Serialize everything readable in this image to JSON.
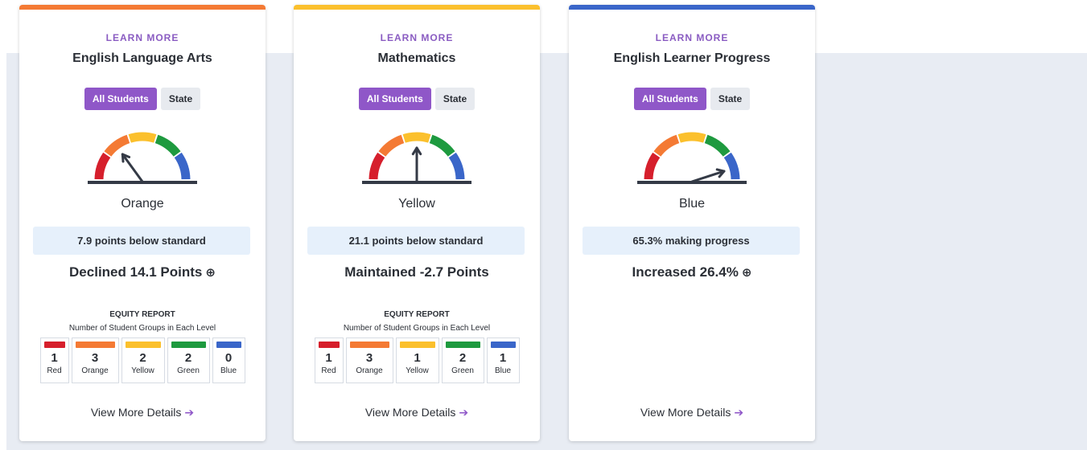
{
  "colors": {
    "red": "#d61f2c",
    "orange": "#f47a34",
    "yellow": "#fbc02d",
    "green": "#1e9a3f",
    "blue": "#3a66c9",
    "accent": "#8f57c8",
    "needle": "#343a46"
  },
  "cards": [
    {
      "accent_color": "#f47a34",
      "learn_more": "LEARN MORE",
      "title": "English Language Arts",
      "toggle_all": "All Students",
      "toggle_state": "State",
      "gauge_level": "orange",
      "gauge_label": "Orange",
      "standard_text": "7.9 points below standard",
      "change_text": "Declined 14.1 Points",
      "change_icon": "arrow-down-circle-icon",
      "equity": {
        "title": "EQUITY REPORT",
        "subtitle": "Number of Student Groups in Each Level",
        "levels": [
          {
            "name": "Red",
            "count": "1"
          },
          {
            "name": "Orange",
            "count": "3"
          },
          {
            "name": "Yellow",
            "count": "2"
          },
          {
            "name": "Green",
            "count": "2"
          },
          {
            "name": "Blue",
            "count": "0"
          }
        ]
      },
      "details_link": "View More Details"
    },
    {
      "accent_color": "#fbc02d",
      "learn_more": "LEARN MORE",
      "title": "Mathematics",
      "toggle_all": "All Students",
      "toggle_state": "State",
      "gauge_level": "yellow",
      "gauge_label": "Yellow",
      "standard_text": "21.1 points below standard",
      "change_text": "Maintained -2.7 Points",
      "equity": {
        "title": "EQUITY REPORT",
        "subtitle": "Number of Student Groups in Each Level",
        "levels": [
          {
            "name": "Red",
            "count": "1"
          },
          {
            "name": "Orange",
            "count": "3"
          },
          {
            "name": "Yellow",
            "count": "1"
          },
          {
            "name": "Green",
            "count": "2"
          },
          {
            "name": "Blue",
            "count": "1"
          }
        ]
      },
      "details_link": "View More Details"
    },
    {
      "accent_color": "#3a66c9",
      "learn_more": "LEARN MORE",
      "title": "English Learner Progress",
      "toggle_all": "All Students",
      "toggle_state": "State",
      "gauge_level": "blue",
      "gauge_label": "Blue",
      "standard_text": "65.3% making progress",
      "change_text": "Increased 26.4%",
      "change_icon": "arrow-up-circle-icon",
      "details_link": "View More Details"
    }
  ]
}
